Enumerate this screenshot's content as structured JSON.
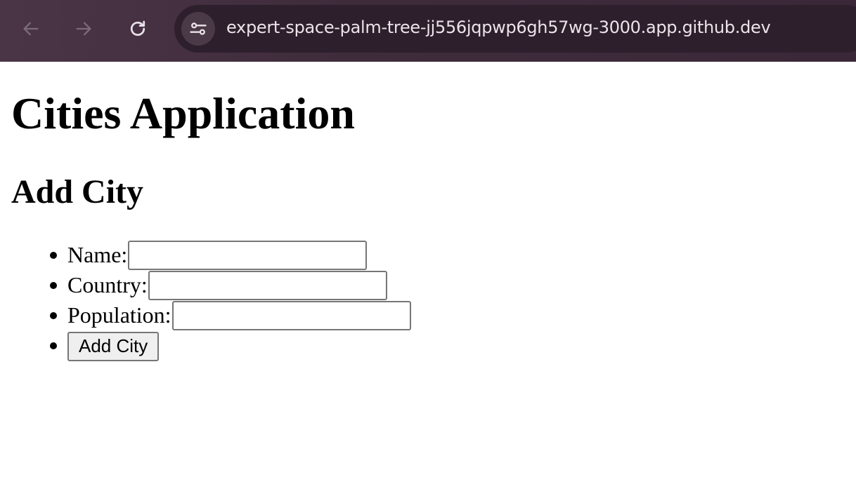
{
  "browser": {
    "url": "expert-space-palm-tree-jj556jqpwp6gh57wg-3000.app.github.dev",
    "back_icon": "arrow-left-icon",
    "forward_icon": "arrow-right-icon",
    "reload_icon": "reload-icon",
    "site_info_icon": "tune-icon",
    "colors": {
      "toolbar": "#4a3546",
      "address_bar": "#2e1f2c",
      "url_text": "#ece4ea"
    }
  },
  "page": {
    "title": "Cities Application",
    "section_title": "Add City",
    "form": {
      "name_label": "Name:",
      "name_value": "",
      "country_label": "Country:",
      "country_value": "",
      "population_label": "Population:",
      "population_value": "",
      "submit_label": "Add City"
    }
  }
}
